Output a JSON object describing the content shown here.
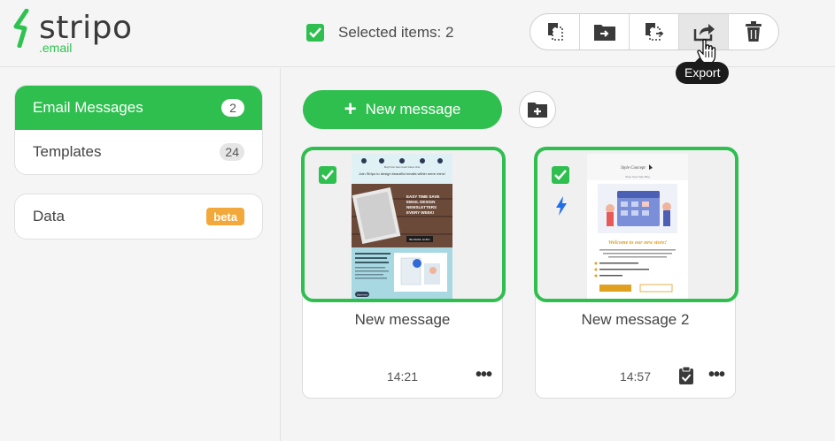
{
  "brand": {
    "name": "stripo",
    "suffix": ".email"
  },
  "selection": {
    "label": "Selected items: 2"
  },
  "toolbar": {
    "buttons": [
      {
        "name": "copy-icon"
      },
      {
        "name": "move-to-folder-icon"
      },
      {
        "name": "duplicate-icon"
      },
      {
        "name": "export-icon"
      },
      {
        "name": "trash-icon"
      }
    ],
    "tooltip": "Export"
  },
  "sidebar": {
    "items": [
      {
        "label": "Email Messages",
        "count": "2"
      },
      {
        "label": "Templates",
        "count": "24"
      }
    ],
    "data": {
      "label": "Data",
      "badge": "beta"
    }
  },
  "actions": {
    "new_message": "New message"
  },
  "messages": [
    {
      "title": "New message",
      "time": "14:21"
    },
    {
      "title": "New message 2",
      "time": "14:57"
    }
  ],
  "preview1": {
    "headline": "Join Stripo to design beautiful emails within mere mins!",
    "promo": "EASY TIME SAVE EMAIL DESIGN NEWSLETTERS EVERY WEEK!",
    "promo_btn": "BE EMAIL GURU",
    "button": "Start here",
    "nav": [
      "Blog Posts",
      "Team",
      "Goals",
      "Videos",
      "Chat"
    ]
  },
  "preview2": {
    "brand": "Style Concept",
    "welcome": "Welcome to our new store!",
    "nav": [
      "Shop",
      "New",
      "Sale",
      "Blog"
    ]
  },
  "colors": {
    "accent": "#2fbf4f",
    "badge": "#f2a83b",
    "bolt": "#1f6feb"
  }
}
